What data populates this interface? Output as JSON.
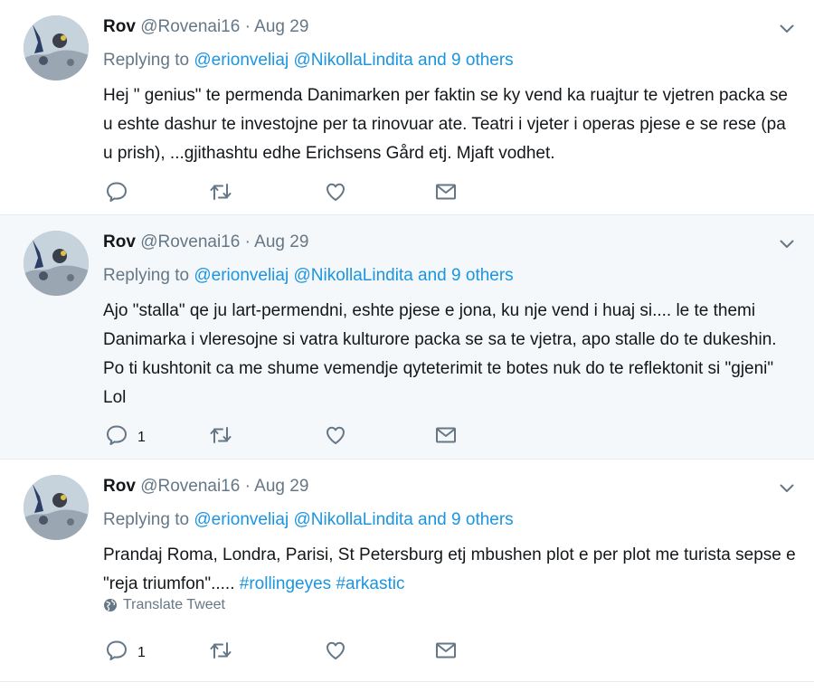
{
  "tweets": [
    {
      "name": "Rov",
      "handle": "@Rovenai16",
      "sep": "·",
      "date": "Aug 29",
      "replying_prefix": "Replying to",
      "mention1": "@erionveliaj",
      "mention2": "@NikollaLindita",
      "others": "and 9 others",
      "text": "Hej \" genius\" te permenda Danimarken per faktin se ky vend ka ruajtur te vjetren packa se u eshte dashur te investojne per ta rinovuar ate. Teatri i vjeter i operas pjese e se rese (pa u prish), ...gjithashtu edhe Erichsens Gård etj. Mjaft vodhet.",
      "reply_count": "",
      "highlighted": false
    },
    {
      "name": "Rov",
      "handle": "@Rovenai16",
      "sep": "·",
      "date": "Aug 29",
      "replying_prefix": "Replying to",
      "mention1": "@erionveliaj",
      "mention2": "@NikollaLindita",
      "others": "and 9 others",
      "text": "Ajo \"stalla\" qe ju lart-permendni, eshte pjese e jona, ku nje vend i huaj si.... le te themi Danimarka i vleresojne si vatra kulturore packa se sa te vjetra, apo stalle do te dukeshin. Po ti kushtonit ca me shume vemendje qyteterimit te botes nuk do te reflektonit si \"gjeni\" Lol",
      "reply_count": "1",
      "highlighted": true
    },
    {
      "name": "Rov",
      "handle": "@Rovenai16",
      "sep": "·",
      "date": "Aug 29",
      "replying_prefix": "Replying to",
      "mention1": "@erionveliaj",
      "mention2": "@NikollaLindita",
      "others": "and 9 others",
      "text_plain": "Prandaj Roma, Londra, Parisi, St Petersburg etj mbushen plot e per plot me turista sepse e \"reja triumfon\".....",
      "hashtag1": "#rollingeyes",
      "hashtag2": "#arkastic",
      "translate_label": "Translate Tweet",
      "reply_count": "1",
      "highlighted": false
    }
  ],
  "icons": {
    "reply": "reply-icon",
    "retweet": "retweet-icon",
    "like": "heart-icon",
    "dm": "envelope-icon",
    "caret": "chevron-down-icon",
    "globe": "globe-icon"
  },
  "colors": {
    "link": "#1b95e0",
    "gray": "#657786",
    "text": "#14171a",
    "highlight_bg": "#f5f8fa"
  }
}
